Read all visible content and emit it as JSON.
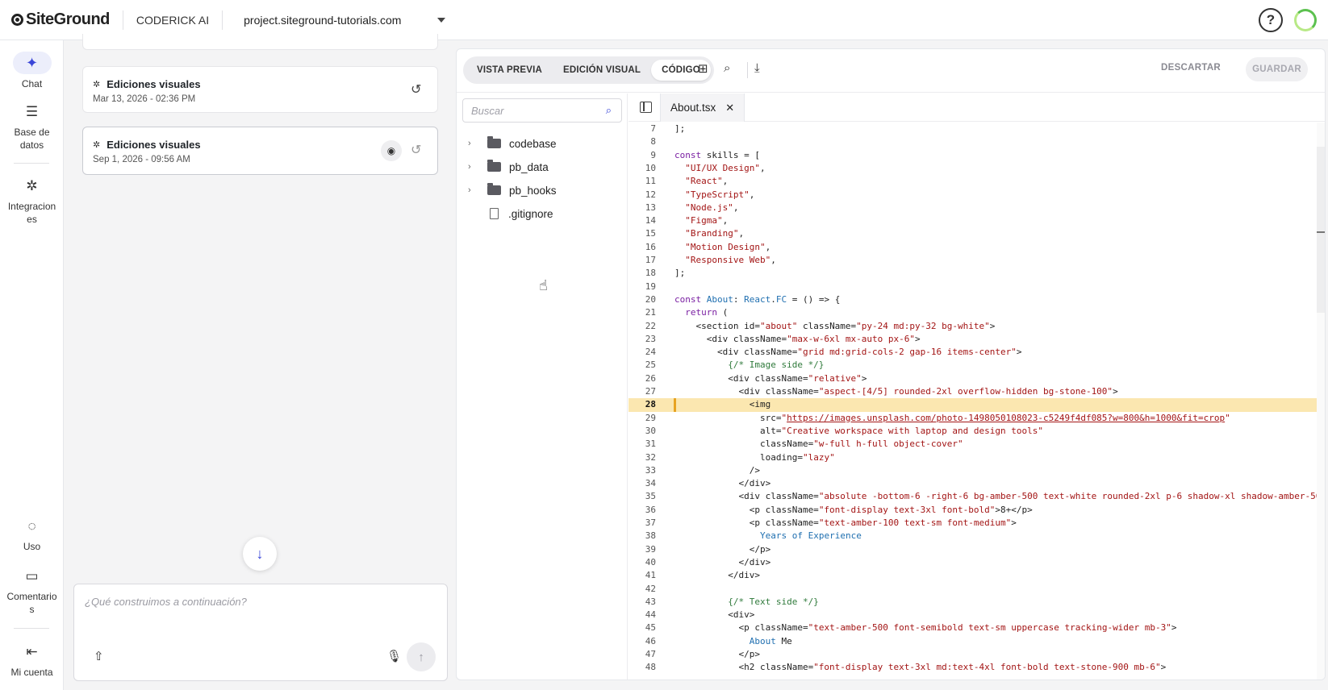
{
  "brand": {
    "name": "SiteGround"
  },
  "header": {
    "app_label": "CODERICK AI",
    "project": "project.siteground-tutorials.com",
    "help_glyph": "?"
  },
  "rail": {
    "top_items": [
      {
        "label": "Chat",
        "icon": "sparkle-icon",
        "glyph": "✦",
        "active": true
      },
      {
        "label": "Base de datos",
        "icon": "database-icon",
        "glyph": "☰"
      },
      {
        "label": "Integraciones",
        "icon": "integrations-icon",
        "glyph": "✲"
      }
    ],
    "bottom_items": [
      {
        "label": "Uso",
        "icon": "usage-icon",
        "glyph": "◌"
      },
      {
        "label": "Comentarios",
        "icon": "feedback-icon",
        "glyph": "▭"
      },
      {
        "label": "Mi cuenta",
        "icon": "logout-icon",
        "glyph": "⇤"
      }
    ]
  },
  "history": {
    "items": [
      {
        "title": "Ediciones visuales",
        "date": "Mar 13, 2026 - 02:36 PM",
        "selected": false
      },
      {
        "title": "Ediciones visuales",
        "date": "Sep 1, 2026 - 09:56 AM",
        "selected": true
      }
    ]
  },
  "composer": {
    "placeholder": "¿Qué construimos a continuación?"
  },
  "editor": {
    "modes": [
      "VISTA PREVIA",
      "EDICIÓN VISUAL",
      "CÓDIGO"
    ],
    "active_mode": "CÓDIGO",
    "discard_label": "DESCARTAR",
    "save_label": "GUARDAR",
    "search_placeholder": "Buscar",
    "tree": [
      {
        "name": "codebase",
        "type": "folder"
      },
      {
        "name": "pb_data",
        "type": "folder"
      },
      {
        "name": "pb_hooks",
        "type": "folder"
      },
      {
        "name": ".gitignore",
        "type": "file"
      }
    ],
    "open_tab": "About.tsx",
    "highlighted_line": 28,
    "first_line": 7,
    "code_lines": [
      "];",
      "",
      "const skills = [",
      "  \"UI/UX Design\",",
      "  \"React\",",
      "  \"TypeScript\",",
      "  \"Node.js\",",
      "  \"Figma\",",
      "  \"Branding\",",
      "  \"Motion Design\",",
      "  \"Responsive Web\",",
      "];",
      "",
      "const About: React.FC = () => {",
      "  return (",
      "    <section id=\"about\" className=\"py-24 md:py-32 bg-white\">",
      "      <div className=\"max-w-6xl mx-auto px-6\">",
      "        <div className=\"grid md:grid-cols-2 gap-16 items-center\">",
      "          {/* Image side */}",
      "          <div className=\"relative\">",
      "            <div className=\"aspect-[4/5] rounded-2xl overflow-hidden bg-stone-100\">",
      "              <img",
      "                src=\"https://images.unsplash.com/photo-1498050108023-c5249f4df085?w=800&h=1000&fit=crop\"",
      "                alt=\"Creative workspace with laptop and design tools\"",
      "                className=\"w-full h-full object-cover\"",
      "                loading=\"lazy\"",
      "              />",
      "            </div>",
      "            <div className=\"absolute -bottom-6 -right-6 bg-amber-500 text-white rounded-2xl p-6 shadow-xl shadow-amber-50",
      "              <p className=\"font-display text-3xl font-bold\">8+</p>",
      "              <p className=\"text-amber-100 text-sm font-medium\">",
      "                Years of Experience",
      "              </p>",
      "            </div>",
      "          </div>",
      "",
      "          {/* Text side */}",
      "          <div>",
      "            <p className=\"text-amber-500 font-semibold text-sm uppercase tracking-wider mb-3\">",
      "              About Me",
      "            </p>",
      "            <h2 className=\"font-display text-3xl md:text-4xl font-bold text-stone-900 mb-6\">"
    ]
  }
}
